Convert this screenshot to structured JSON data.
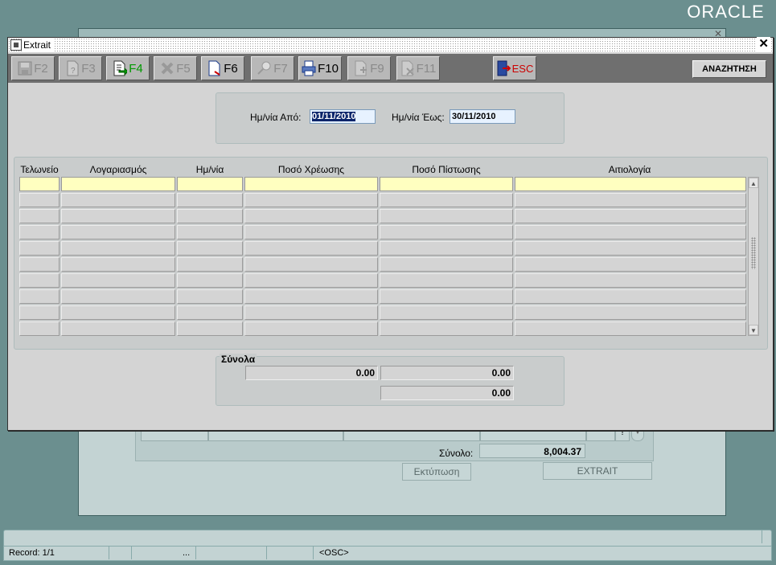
{
  "brand": {
    "logo": "ORACLE"
  },
  "background_window": {
    "total_label": "Σύνολο:",
    "total_value": "8,004.37",
    "print_button": "Εκτύπωση",
    "extrait_button": "EXTRAIT"
  },
  "dialog": {
    "title": "Extrait",
    "close_glyph": "✕",
    "toolbar": {
      "buttons": [
        {
          "key": "F2",
          "enabled": false,
          "icon": "save-icon"
        },
        {
          "key": "F3",
          "enabled": false,
          "icon": "query-icon"
        },
        {
          "key": "F4",
          "enabled": true,
          "icon": "execute-query-icon"
        },
        {
          "key": "F5",
          "enabled": false,
          "icon": "delete-icon"
        },
        {
          "key": "F6",
          "enabled": true,
          "icon": "clear-icon"
        },
        {
          "key": "F7",
          "enabled": false,
          "icon": "zoom-icon"
        },
        {
          "key": "F10",
          "enabled": true,
          "icon": "print-icon"
        },
        {
          "key": "F9",
          "enabled": false,
          "icon": "insert-record-icon"
        },
        {
          "key": "F11",
          "enabled": false,
          "icon": "delete-record-icon"
        },
        {
          "key": "ESC",
          "enabled": true,
          "icon": "exit-door-icon"
        }
      ],
      "search_label": "ΑΝΑΖΗΤΗΣΗ"
    },
    "date_filter": {
      "from_label": "Ημ/νία Από:",
      "from_value": "01/11/2010",
      "to_label": "Ημ/νία Έως:",
      "to_value": "30/11/2010"
    },
    "grid": {
      "columns": [
        "Τελωνείο",
        "Λογαριασμός",
        "Ημ/νία",
        "Ποσό Χρέωσης",
        "Ποσό Πίστωσης",
        "Αιτιολογία"
      ],
      "row_count": 10
    },
    "totals": {
      "title": "Σύνολα",
      "debit_total": "0.00",
      "credit_total": "0.00",
      "balance": "0.00"
    }
  },
  "statusbar": {
    "record": "Record: 1/1",
    "ellipsis": "...",
    "mode": "<OSC>"
  }
}
